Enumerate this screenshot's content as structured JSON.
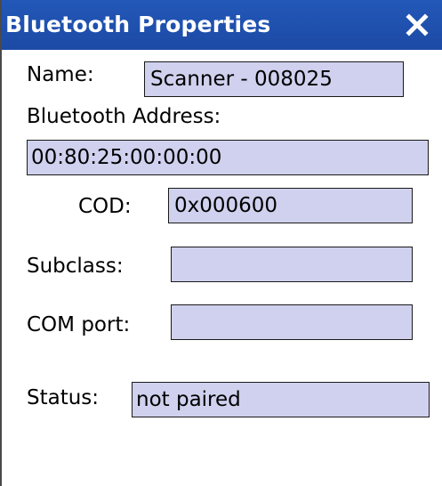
{
  "window": {
    "title": "Bluetooth Properties",
    "close_icon": "close-icon"
  },
  "fields": {
    "name": {
      "label": "Name:",
      "value": "Scanner - 008025"
    },
    "address": {
      "label": "Bluetooth Address:",
      "value": "00:80:25:00:00:00"
    },
    "cod": {
      "label": "COD:",
      "value": "0x000600"
    },
    "subclass": {
      "label": "Subclass:",
      "value": ""
    },
    "com_port": {
      "label": "COM port:",
      "value": ""
    },
    "status": {
      "label": "Status:",
      "value": "not paired"
    }
  },
  "colors": {
    "titlebar": "#2358b8",
    "field_background": "#cfd1ee",
    "field_border": "#1a1a1a"
  }
}
